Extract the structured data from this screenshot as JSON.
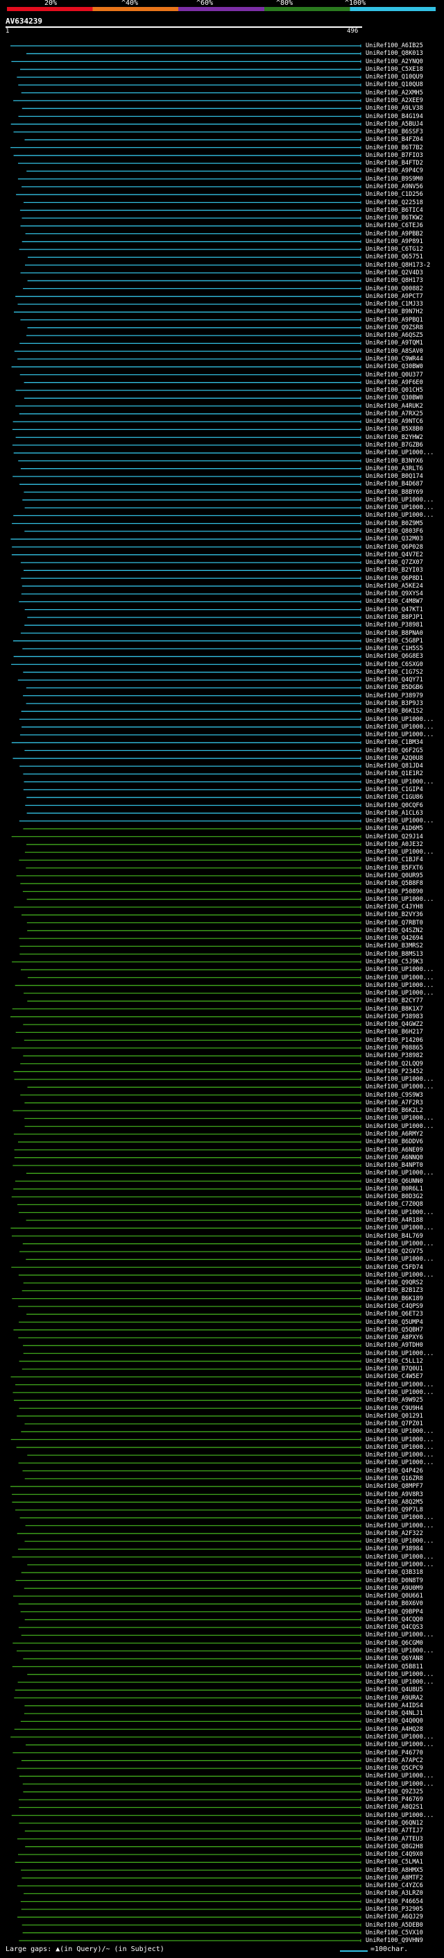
{
  "chart_data": {
    "type": "bar",
    "title": "AV634239",
    "query_length": 496,
    "legend": {
      "ticks": [
        "20%",
        "^40%",
        "^60%",
        "^80%",
        "^100%"
      ],
      "colors": [
        "#e30d1e",
        "#e8751a",
        "#7d2fa6",
        "#2b7a1f",
        "#33c1e3"
      ]
    },
    "axis": {
      "start_label": "1",
      "end_label": "496"
    },
    "colors": {
      "high": "#33c1e3",
      "mid": "#40a81c",
      "query": "#ffffff"
    },
    "hit_ids": [
      "UniRef100_A6IB25",
      "UniRef100_Q8K013",
      "UniRef100_A2YNQ0",
      "UniRef100_C5XE18",
      "UniRef100_Q10QU9",
      "UniRef100_Q10QU8",
      "UniRef100_A2XMH5",
      "UniRef100_A2XEE9",
      "UniRef100_A9LV38",
      "UniRef100_B4G194",
      "UniRef100_A5BUJ4",
      "UniRef100_B6SSF3",
      "UniRef100_B4FZ04",
      "UniRef100_B6T7B2",
      "UniRef100_B7FIO3",
      "UniRef100_B4FTD2",
      "UniRef100_A9P4C9",
      "UniRef100_B9S9M0",
      "UniRef100_A9NV56",
      "UniRef100_C1D256",
      "UniRef100_Q22518",
      "UniRef100_B6TIC4",
      "UniRef100_B6TKW2",
      "UniRef100_C6TEJ6",
      "UniRef100_A9PBB2",
      "UniRef100_A9P891",
      "UniRef100_C6TG12",
      "UniRef100_Q65751",
      "UniRef100_Q8H173-2",
      "UniRef100_Q2V4D3",
      "UniRef100_Q8H173",
      "UniRef100_Q00882",
      "UniRef100_A9PCT7",
      "UniRef100_C1MJ33",
      "UniRef100_B9N7H2",
      "UniRef100_A9PBQ1",
      "UniRef100_Q9ZSR8",
      "UniRef100_A6QSZ5",
      "UniRef100_A9TQM1",
      "UniRef100_A8SAV0",
      "UniRef100_C9WR44",
      "UniRef100_Q30BW0",
      "UniRef100_Q0U377",
      "UniRef100_A9F6E0",
      "UniRef100_Q01CH5",
      "UniRef100_Q30BW0",
      "UniRef100_A4RUK2",
      "UniRef100_A7RX25",
      "UniRef100_A9NTC6",
      "UniRef100_B5X8B0",
      "UniRef100_B2YHW2",
      "UniRef100_B7GZB6",
      "UniRef100_UP1000...",
      "UniRef100_B3NYX6",
      "UniRef100_A3RLT6",
      "UniRef100_B0Q174",
      "UniRef100_B4D687",
      "UniRef100_B8BY69",
      "UniRef100_UP1000...",
      "UniRef100_UP1000...",
      "UniRef100_UP1000...",
      "UniRef100_B0Z9M5",
      "UniRef100_Q803F6",
      "UniRef100_Q32M03",
      "UniRef100_Q6P028",
      "UniRef100_Q4V7E2",
      "UniRef100_Q7ZX07",
      "UniRef100_B2YI03",
      "UniRef100_Q6P8D1",
      "UniRef100_A5KE24",
      "UniRef100_Q9XYS4",
      "UniRef100_C4M8W7",
      "UniRef100_Q47KT1",
      "UniRef100_B8PJP1",
      "UniRef100_P38981",
      "UniRef100_B8PNA0",
      "UniRef100_C5G8P1",
      "UniRef100_C1H5S5",
      "UniRef100_Q6G8E3",
      "UniRef100_C6SXG0",
      "UniRef100_C1G7S2",
      "UniRef100_Q4QY71",
      "UniRef100_B5DGB6",
      "UniRef100_P38979",
      "UniRef100_B3P9J3",
      "UniRef100_B6K1S2",
      "UniRef100_UP1000...",
      "UniRef100_UP1000...",
      "UniRef100_UP1000...",
      "UniRef100_C1BM34",
      "UniRef100_Q6F2G5",
      "UniRef100_A2Q0U8",
      "UniRef100_Q81JD4",
      "UniRef100_Q1E1R2",
      "UniRef100_UP1000...",
      "UniRef100_C1GIP4",
      "UniRef100_C1GU86",
      "UniRef100_Q0CQF6",
      "UniRef100_A1CL63",
      "UniRef100_UP1000...",
      "UniRef100_A1D6M5",
      "UniRef100_Q29J14",
      "UniRef100_A0JE32",
      "UniRef100_UP1000...",
      "UniRef100_C1BJF4",
      "UniRef100_B5FXT6",
      "UniRef100_Q0UR95",
      "UniRef100_Q5B8F8",
      "UniRef100_P50890",
      "UniRef100_UP1000...",
      "UniRef100_C4JYH8",
      "UniRef100_B2VY36",
      "UniRef100_Q7RBT0",
      "UniRef100_Q4SZN2",
      "UniRef100_Q42694",
      "UniRef100_B3MRS2",
      "UniRef100_B8MS13",
      "UniRef100_C5J9K3",
      "UniRef100_UP1000...",
      "UniRef100_UP1000...",
      "UniRef100_UP1000...",
      "UniRef100_UP1000...",
      "UniRef100_B2CY77",
      "UniRef100_B8K1X7",
      "UniRef100_P38983",
      "UniRef100_Q4GWZ2",
      "UniRef100_B6H217",
      "UniRef100_P14206",
      "UniRef100_P08865",
      "UniRef100_P38982",
      "UniRef100_Q2LQQ9",
      "UniRef100_P23452",
      "UniRef100_UP1000...",
      "UniRef100_UP1000...",
      "UniRef100_C9S9W3",
      "UniRef100_A7F2R3",
      "UniRef100_B6K2L2",
      "UniRef100_UP1000...",
      "UniRef100_UP1000...",
      "UniRef100_A6RMY2",
      "UniRef100_B6DDV6",
      "UniRef100_A6NE09",
      "UniRef100_A6NNQ0",
      "UniRef100_B4NPT0",
      "UniRef100_UP1000...",
      "UniRef100_Q6UNN0",
      "UniRef100_B0R6L1",
      "UniRef100_B0D3G2",
      "UniRef100_C7Z0Q8",
      "UniRef100_UP1000...",
      "UniRef100_A4R188",
      "UniRef100_UP1000...",
      "UniRef100_B4L769",
      "UniRef100_UP1000...",
      "UniRef100_Q2GV75",
      "UniRef100_UP1000...",
      "UniRef100_C5FD74",
      "UniRef100_UP1000...",
      "UniRef100_Q9QRS2",
      "UniRef100_B2B1Z3",
      "UniRef100_B6K189",
      "UniRef100_C4QPS9",
      "UniRef100_Q6ET23",
      "UniRef100_Q5UMP4",
      "UniRef100_Q5QBH7",
      "UniRef100_A8PXY6",
      "UniRef100_A9TDH0",
      "UniRef100_UP1000...",
      "UniRef100_C5LL12",
      "UniRef100_B7Q0U1",
      "UniRef100_C4W5E7",
      "UniRef100_UP1000...",
      "UniRef100_UP1000...",
      "UniRef100_A9W925",
      "UniRef100_C9U9H4",
      "UniRef100_Q01291",
      "UniRef100_Q7PZ01",
      "UniRef100_UP1000...",
      "UniRef100_UP1000...",
      "UniRef100_UP1000...",
      "UniRef100_UP1000...",
      "UniRef100_UP1000...",
      "UniRef100_Q4P426",
      "UniRef100_Q16ZR8",
      "UniRef100_Q8MPF7",
      "UniRef100_A9V8R3",
      "UniRef100_A8Q2M5",
      "UniRef100_Q9P7L8",
      "UniRef100_UP1000...",
      "UniRef100_UP1000...",
      "UniRef100_A2F322",
      "UniRef100_UP1000...",
      "UniRef100_P38984",
      "UniRef100_UP1000...",
      "UniRef100_UP1000...",
      "UniRef100_Q3B318",
      "UniRef100_D0N8T9",
      "UniRef100_A9U0M9",
      "UniRef100_Q0U661",
      "UniRef100_B0X6V0",
      "UniRef100_Q9BPP4",
      "UniRef100_Q4CQQ0",
      "UniRef100_Q4CQS3",
      "UniRef100_UP1000...",
      "UniRef100_Q6CGM0",
      "UniRef100_UP1000...",
      "UniRef100_Q6YAN8",
      "UniRef100_Q5B811",
      "UniRef100_UP1000...",
      "UniRef100_UP1000...",
      "UniRef100_Q4U8U5",
      "UniRef100_A9URA2",
      "UniRef100_A4IDS4",
      "UniRef100_Q4NLJ1",
      "UniRef100_Q4Q0Q0",
      "UniRef100_A4HQ28",
      "UniRef100_UP1000...",
      "UniRef100_UP1000...",
      "UniRef100_P46770",
      "UniRef100_A7APC2",
      "UniRef100_Q5CPC9",
      "UniRef100_UP1000...",
      "UniRef100_UP1000...",
      "UniRef100_Q9Z325",
      "UniRef100_P46769",
      "UniRef100_A8Q2S1",
      "UniRef100_UP1000...",
      "UniRef100_Q6QN12",
      "UniRef100_A7TIJ7",
      "UniRef100_A7TEU3",
      "UniRef100_Q8G2H8",
      "UniRef100_C4Q9X0",
      "UniRef100_C5LMA1",
      "UniRef100_A8HMX5",
      "UniRef100_A8MTF2",
      "UniRef100_C4YZC6",
      "UniRef100_A3LRZ0",
      "UniRef100_P46654",
      "UniRef100_P32905",
      "UniRef100_A6QJ29",
      "UniRef100_A5DEB0",
      "UniRef100_C5VX10",
      "UniRef100_Q9VHN9"
    ]
  },
  "footer": {
    "gaps_text": "Large gaps: ▲(in Query)/~ (in Subject)",
    "scale_text": "=100char."
  }
}
